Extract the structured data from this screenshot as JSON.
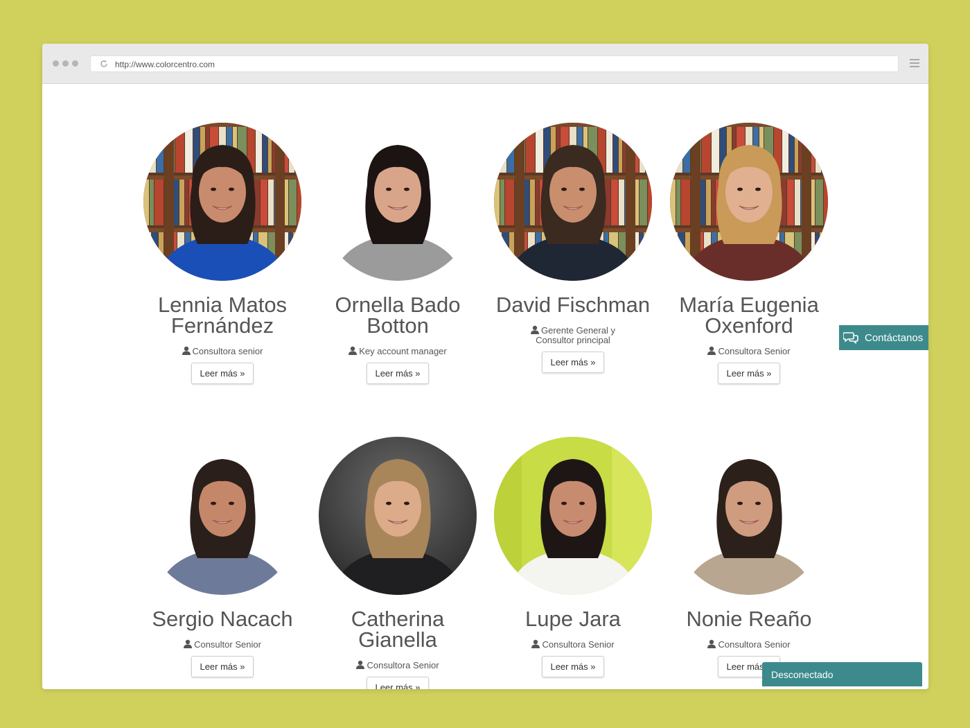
{
  "browser": {
    "url": "http://www.colorcentro.com"
  },
  "team": [
    {
      "name": "Lennia Matos Fernández",
      "role": "Consultora senior",
      "button": "Leer más »",
      "bg": "books",
      "skin": "#c98b6d",
      "hair": "#2b1e18",
      "shirt": "#1a4fb8"
    },
    {
      "name": "Ornella Bado Botton",
      "role": "Key account manager",
      "button": "Leer más »",
      "bg": "white",
      "skin": "#d9a58a",
      "hair": "#1c1412",
      "shirt": "#9b9b9b"
    },
    {
      "name": "David Fischman",
      "role": "Gerente General y Consultor principal",
      "button": "Leer más »",
      "bg": "books",
      "skin": "#c88e6e",
      "hair": "#3a2a20",
      "shirt": "#1f2735"
    },
    {
      "name": "María Eugenia Oxenford",
      "role": "Consultora Senior",
      "button": "Leer más »",
      "bg": "books",
      "skin": "#e0b090",
      "hair": "#c99a58",
      "shirt": "#6a2e2a"
    },
    {
      "name": "Sergio Nacach",
      "role": "Consultor Senior",
      "button": "Leer más »",
      "bg": "white",
      "skin": "#c4876a",
      "hair": "#2a1f1a",
      "shirt": "#6e7a99"
    },
    {
      "name": "Catherina Gianella",
      "role": "Consultora Senior",
      "button": "Leer más »",
      "bg": "dark",
      "skin": "#dcab8a",
      "hair": "#a9855a",
      "shirt": "#1f1f22"
    },
    {
      "name": "Lupe Jara",
      "role": "Consultora Senior",
      "button": "Leer más »",
      "bg": "lime",
      "skin": "#c78c70",
      "hair": "#1e1614",
      "shirt": "#f4f4f0"
    },
    {
      "name": "Nonie Reaño",
      "role": "Consultora Senior",
      "button": "Leer más »",
      "bg": "white",
      "skin": "#cf9c80",
      "hair": "#2c211a",
      "shirt": "#b8a690"
    }
  ],
  "contact_tab": {
    "label": "Contáctanos"
  },
  "chat_status": {
    "label": "Desconectado"
  },
  "colors": {
    "page_bg": "#d0d15d",
    "accent": "#3d8a8c"
  }
}
